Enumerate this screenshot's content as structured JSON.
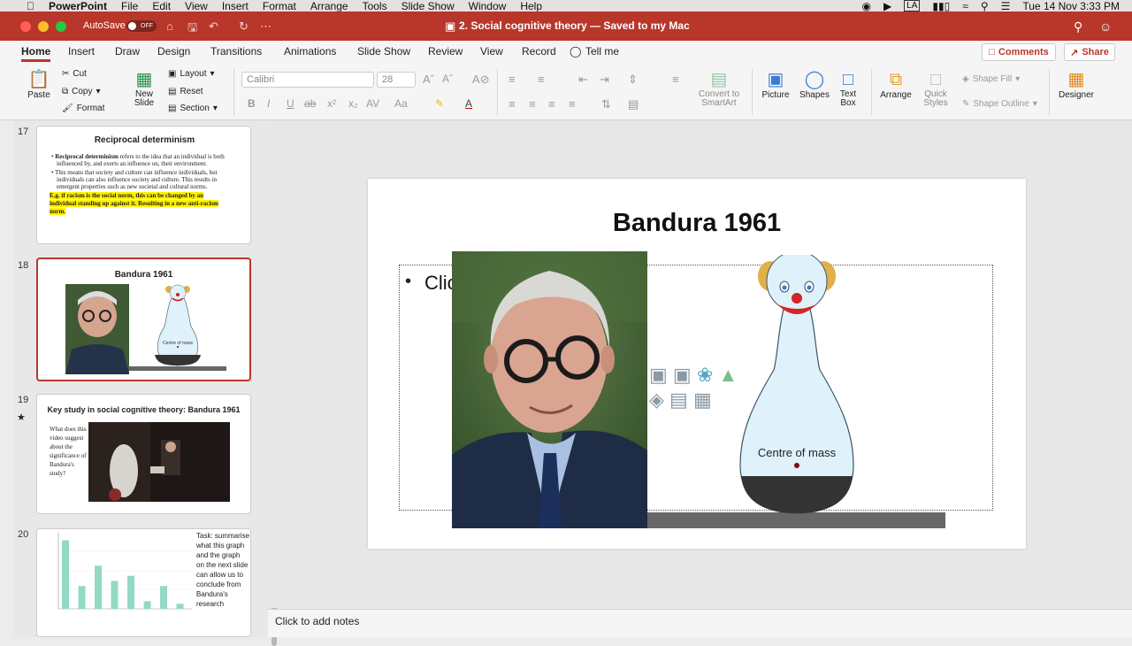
{
  "menubar": {
    "app": "PowerPoint",
    "items": [
      "File",
      "Edit",
      "View",
      "Insert",
      "Format",
      "Arrange",
      "Tools",
      "Slide Show",
      "Window",
      "Help"
    ],
    "user_initials": "LA",
    "datetime": "Tue 14 Nov  3:33 PM"
  },
  "titlebar": {
    "autosave_label": "AutoSave",
    "autosave_state": "OFF",
    "document_title": "2. Social cognitive theory — Saved to my Mac"
  },
  "tabs": [
    "Home",
    "Insert",
    "Draw",
    "Design",
    "Transitions",
    "Animations",
    "Slide Show",
    "Review",
    "View",
    "Record",
    "Tell me"
  ],
  "active_tab": "Home",
  "comments_label": "Comments",
  "share_label": "Share",
  "ribbon": {
    "paste": "Paste",
    "cut": "Cut",
    "copy": "Copy",
    "format": "Format",
    "new_slide": "New Slide",
    "layout": "Layout",
    "reset": "Reset",
    "section": "Section",
    "font_name": "Calibri",
    "font_size": "28",
    "convert": "Convert to SmartArt",
    "picture": "Picture",
    "shapes": "Shapes",
    "text_box": "Text Box",
    "arrange": "Arrange",
    "quick_styles": "Quick Styles",
    "shape_fill": "Shape Fill",
    "shape_outline": "Shape Outline",
    "designer": "Designer"
  },
  "thumbnails": [
    {
      "number": "17",
      "title": "Reciprocal determinism",
      "bullet1_bold": "Reciprocal determinism",
      "bullet1_rest": " refers to the idea that an individual is both influenced by, and exerts an influence on, their environment.",
      "bullet2": "This means that society and culture can influence individuals, but individuals can also influence society and culture. This results in emergent properties such as new societal and cultural norms.",
      "highlight": "E.g. if racism is the social norm, this can be changed by an individual standing up against it. Resulting in a new anti-racism norm."
    },
    {
      "number": "18",
      "title": "Bandura 1961",
      "label": "Centre of mass"
    },
    {
      "number": "19",
      "title": "Key study in social cognitive theory: Bandura 1961",
      "text": "What does this video suggest about the significance of Bandura's study?"
    },
    {
      "number": "20",
      "task": "Task: summarise what this graph and the graph on the next slide can allow us to conclude from Bandura's research",
      "values": [
        27,
        9,
        17,
        11,
        13,
        3,
        9,
        2
      ]
    }
  ],
  "slide": {
    "title": "Bandura 1961",
    "bullet_placeholder": "Clic",
    "doll_label": "Centre of mass"
  },
  "notes_placeholder": "Click to add notes",
  "colors": {
    "accent": "#b8372a",
    "doll_body": "#dff1fb",
    "highlight": "#fff200"
  }
}
